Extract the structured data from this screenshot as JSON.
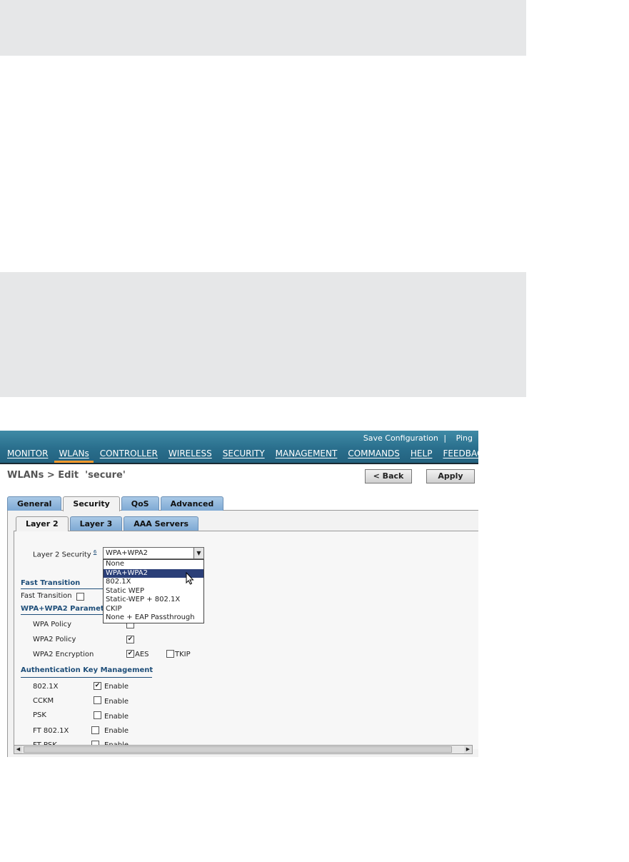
{
  "topbar": {
    "save_configuration": "Save Configuration",
    "separator": "|",
    "ping": "Ping"
  },
  "menu": [
    "MONITOR",
    "WLANs",
    "CONTROLLER",
    "WIRELESS",
    "SECURITY",
    "MANAGEMENT",
    "COMMANDS",
    "HELP",
    "FEEDBACK"
  ],
  "menu_selected": "WLANs",
  "page": {
    "title": "WLANs > Edit  'secure'",
    "back_label": "< Back",
    "apply_label": "Apply"
  },
  "tabs": [
    "General",
    "Security",
    "QoS",
    "Advanced"
  ],
  "tabs_selected": "Security",
  "subtabs": [
    "Layer 2",
    "Layer 3",
    "AAA Servers"
  ],
  "subtabs_selected": "Layer 2",
  "layer2": {
    "security_label": "Layer 2 Security",
    "security_footnote": "6",
    "security_value": "WPA+WPA2",
    "options": [
      "None",
      "WPA+WPA2",
      "802.1X",
      "Static WEP",
      "Static-WEP + 802.1X",
      "CKIP",
      "None + EAP Passthrough"
    ],
    "highlighted_option": "WPA+WPA2"
  },
  "fast_transition": {
    "heading": "Fast Transition",
    "label": "Fast Transition",
    "checked": false
  },
  "wpa_params": {
    "heading": "WPA+WPA2 Parameters",
    "wpa_policy_label": "WPA Policy",
    "wpa_policy_checked": false,
    "wpa2_policy_label": "WPA2 Policy",
    "wpa2_policy_checked": true,
    "wpa2_encryption_label": "WPA2 Encryption",
    "aes_label": "AES",
    "aes_checked": true,
    "tkip_label": "TKIP",
    "tkip_checked": false
  },
  "akm": {
    "heading": "Authentication Key Management",
    "enable_label": "Enable",
    "rows": [
      {
        "label": "802.1X",
        "checked": true
      },
      {
        "label": "CCKM",
        "checked": false
      },
      {
        "label": "PSK",
        "checked": false
      },
      {
        "label": "FT 802.1X",
        "checked": false
      },
      {
        "label": "FT PSK",
        "checked": false
      }
    ]
  }
}
